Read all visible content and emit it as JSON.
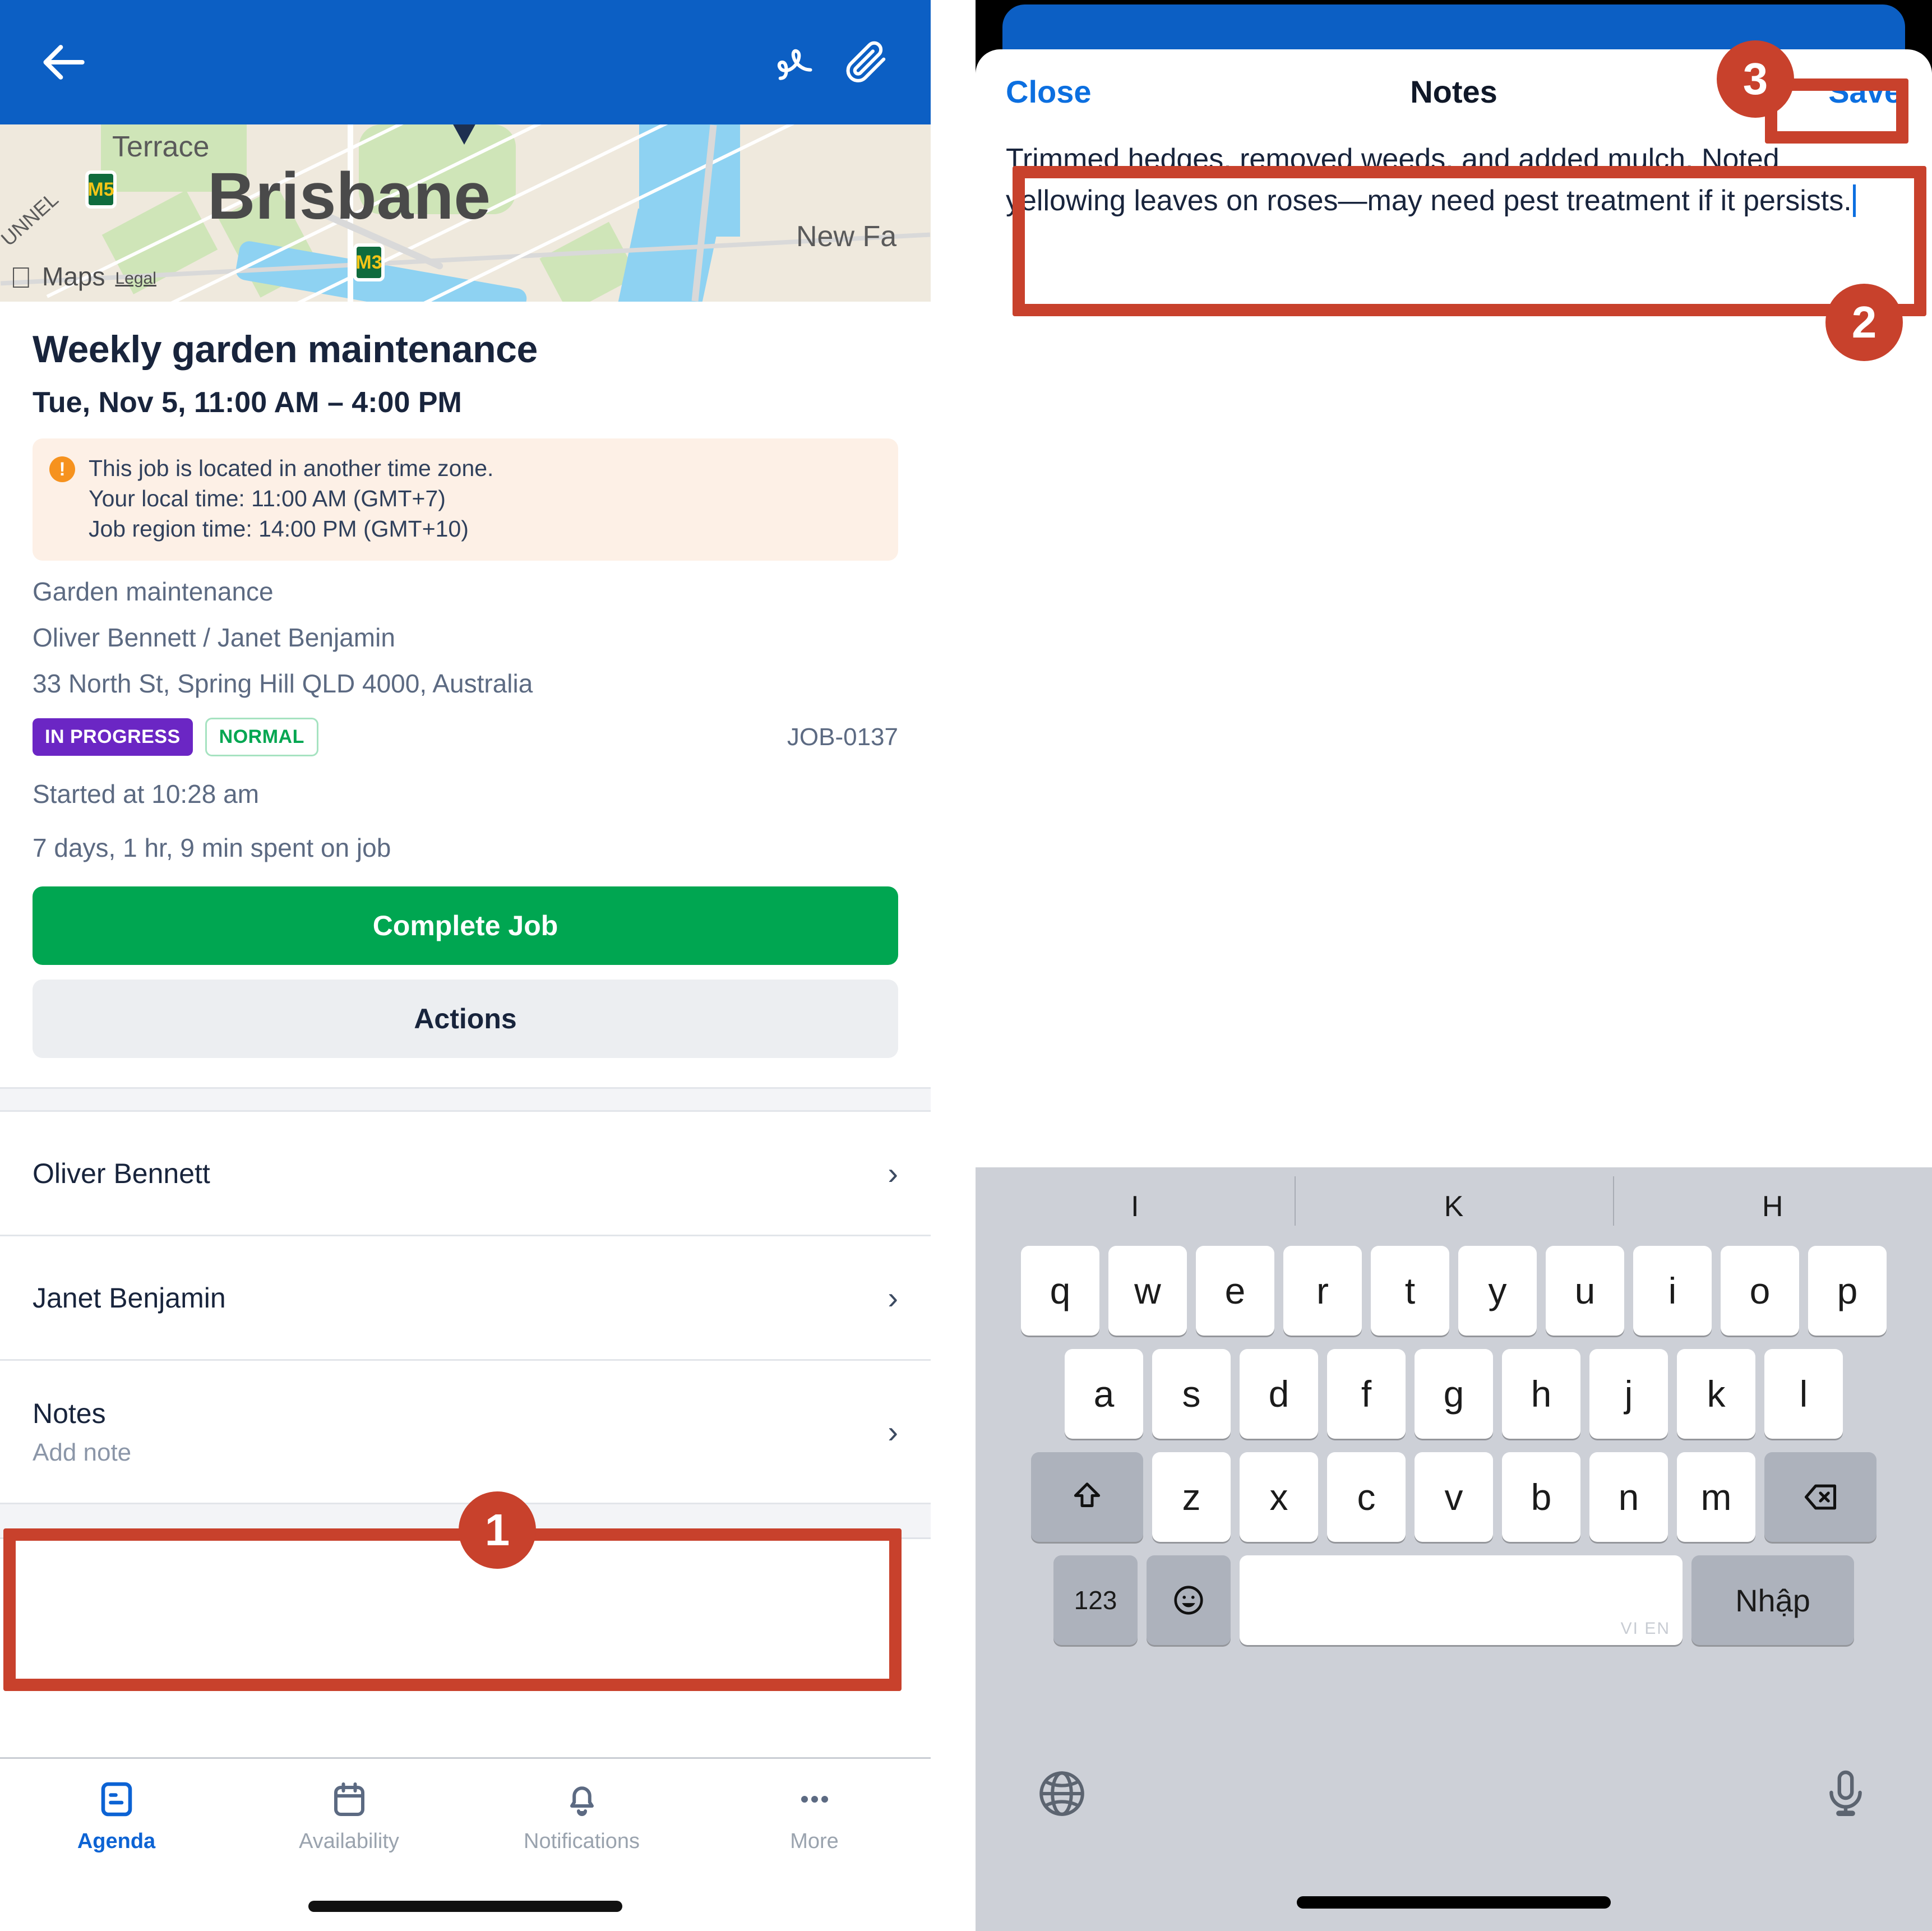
{
  "left": {
    "topbar": {
      "back_icon": "back-arrow-icon",
      "signature_icon": "signature-icon",
      "attachment_icon": "paperclip-icon"
    },
    "map": {
      "city_label": "Brisbane",
      "street_label": "Terrace",
      "suburb_label": "New Fa",
      "tunnel_label": "UNNEL",
      "shield_1": "M5",
      "shield_2": "M3",
      "attribution": "Maps",
      "legal": "Legal"
    },
    "job": {
      "title": "Weekly garden maintenance",
      "date_range": "Tue, Nov 5, 11:00 AM – 4:00 PM",
      "alert": {
        "icon": "warning-icon",
        "line1": "This job is located in another time zone.",
        "line2": "Your local time: 11:00 AM (GMT+7)",
        "line3": "Job region time: 14:00 PM (GMT+10)"
      },
      "category": "Garden maintenance",
      "people": "Oliver Bennett / Janet Benjamin",
      "address": "33 North St, Spring Hill QLD 4000, Australia",
      "status_badge": "IN PROGRESS",
      "priority_badge": "NORMAL",
      "job_code": "JOB-0137",
      "started_at": "Started at 10:28 am",
      "time_spent": "7 days, 1 hr, 9 min spent on job",
      "complete_button": "Complete Job",
      "actions_button": "Actions"
    },
    "list": [
      {
        "title": "Oliver Bennett",
        "sub": "",
        "chevron": "chevron-right-icon"
      },
      {
        "title": "Janet Benjamin",
        "sub": "",
        "chevron": "chevron-right-icon"
      },
      {
        "title": "Notes",
        "sub": "Add note",
        "chevron": "chevron-right-icon"
      }
    ],
    "tabs": [
      {
        "label": "Agenda",
        "icon": "agenda-icon",
        "active": true
      },
      {
        "label": "Availability",
        "icon": "calendar-icon",
        "active": false
      },
      {
        "label": "Notifications",
        "icon": "bell-icon",
        "active": false
      },
      {
        "label": "More",
        "icon": "ellipsis-icon",
        "active": false
      }
    ]
  },
  "right": {
    "navbar": {
      "close_label": "Close",
      "title": "Notes",
      "save_label": "Save"
    },
    "note_text": "Trimmed hedges, removed weeds, and added mulch. Noted yellowing leaves on roses—may need pest treatment if it persists.",
    "keyboard": {
      "suggestions": [
        "I",
        "K",
        "H"
      ],
      "row1": [
        "q",
        "w",
        "e",
        "r",
        "t",
        "y",
        "u",
        "i",
        "o",
        "p"
      ],
      "row2": [
        "a",
        "s",
        "d",
        "f",
        "g",
        "h",
        "j",
        "k",
        "l"
      ],
      "row3": [
        "z",
        "x",
        "c",
        "v",
        "b",
        "n",
        "m"
      ],
      "shift_icon": "shift-icon",
      "backspace_icon": "backspace-icon",
      "numbers_key": "123",
      "emoji_icon": "emoji-icon",
      "space_hint": "VI EN",
      "enter_key": "Nhập",
      "globe_icon": "globe-icon",
      "mic_icon": "microphone-icon"
    }
  },
  "annotations": {
    "badge1": "1",
    "badge2": "2",
    "badge3": "3"
  },
  "colors": {
    "brand_blue": "#0c5fc4",
    "link_blue": "#0c6fe0",
    "green": "#00a651",
    "purple": "#6b26c4",
    "annotation_red": "#c8412c",
    "warning_orange": "#f6921e"
  }
}
